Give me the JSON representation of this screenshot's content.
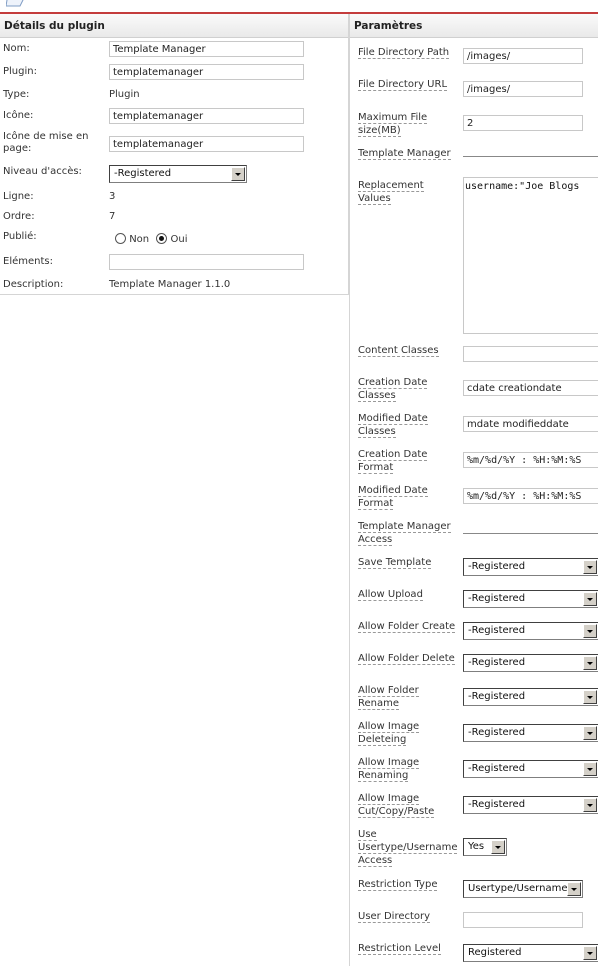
{
  "plugin_details": {
    "header": "Détails du plugin",
    "name_label": "Nom:",
    "name_value": "Template Manager",
    "plugin_label": "Plugin:",
    "plugin_value": "templatemanager",
    "type_label": "Type:",
    "type_value": "Plugin",
    "icon_label": "Icône:",
    "icon_value": "templatemanager",
    "layout_icon_label": "Icône de mise en page:",
    "layout_icon_value": "templatemanager",
    "access_label": "Niveau d'accès:",
    "access_value": "-Registered",
    "line_label": "Ligne:",
    "line_value": "3",
    "order_label": "Ordre:",
    "order_value": "7",
    "published_label": "Publié:",
    "published_no": "Non",
    "published_yes": "Oui",
    "published_selected": "Oui",
    "elements_label": "Eléments:",
    "elements_value": "",
    "description_label": "Description:",
    "description_value": "Template Manager 1.1.0"
  },
  "parameters": {
    "header": "Paramètres",
    "file_dir_path_label": "File Directory Path",
    "file_dir_path_value": "/images/",
    "file_dir_url_label": "File Directory URL",
    "file_dir_url_value": "/images/",
    "max_file_size_label": "Maximum File size(MB)",
    "max_file_size_value": "2",
    "template_manager_label": "Template Manager",
    "replacement_values_label": "Replacement Values",
    "replacement_values_value": "username:\"Joe Blogs",
    "content_classes_label": "Content Classes",
    "content_classes_value": "",
    "creation_date_classes_label": "Creation Date Classes",
    "creation_date_classes_value": "cdate creationdate",
    "modified_date_classes_label": "Modified Date Classes",
    "modified_date_classes_value": "mdate modifieddate",
    "creation_date_format_label": "Creation Date Format",
    "creation_date_format_value": "%m/%d/%Y : %H:%M:%S",
    "modified_date_format_label": "Modified Date Format",
    "modified_date_format_value": "%m/%d/%Y : %H:%M:%S",
    "tm_access_label": "Template Manager Access",
    "save_template_label": "Save Template",
    "save_template_value": "-Registered",
    "allow_upload_label": "Allow Upload",
    "allow_upload_value": "-Registered",
    "allow_folder_create_label": "Allow Folder Create",
    "allow_folder_create_value": "-Registered",
    "allow_folder_delete_label": "Allow Folder Delete",
    "allow_folder_delete_value": "-Registered",
    "allow_folder_rename_label": "Allow Folder Rename",
    "allow_folder_rename_value": "-Registered",
    "allow_image_deleting_label": "Allow Image Deleteing",
    "allow_image_deleting_value": "-Registered",
    "allow_image_renaming_label": "Allow Image Renaming",
    "allow_image_renaming_value": "-Registered",
    "allow_image_ccp_label": "Allow Image Cut/Copy/Paste",
    "allow_image_ccp_value": "-Registered",
    "use_usertype_label": "Use Usertype/Username Access",
    "use_usertype_value": "Yes",
    "restriction_type_label": "Restriction Type",
    "restriction_type_value": "Usertype/Username",
    "user_directory_label": "User Directory",
    "user_directory_value": "",
    "restriction_level_label": "Restriction Level",
    "restriction_level_value": "Registered"
  }
}
